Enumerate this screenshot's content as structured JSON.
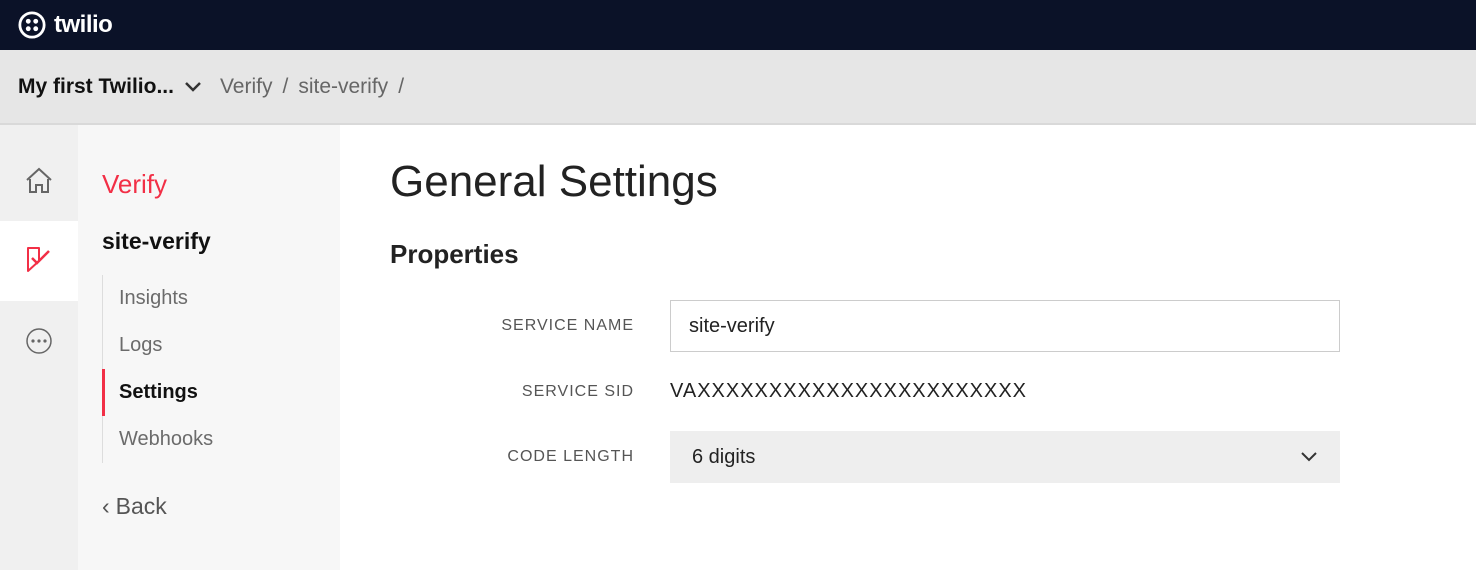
{
  "brand": "twilio",
  "breadcrumb": {
    "account": "My first Twilio...",
    "items": [
      "Verify",
      "site-verify"
    ]
  },
  "sidebar": {
    "product": "Verify",
    "service": "site-verify",
    "nav": [
      {
        "label": "Insights",
        "active": false
      },
      {
        "label": "Logs",
        "active": false
      },
      {
        "label": "Settings",
        "active": true
      },
      {
        "label": "Webhooks",
        "active": false
      }
    ],
    "back_label": "Back"
  },
  "page": {
    "title": "General Settings",
    "section": "Properties",
    "fields": {
      "service_name": {
        "label": "SERVICE NAME",
        "value": "site-verify"
      },
      "service_sid": {
        "label": "SERVICE SID",
        "value": "VAXXXXXXXXXXXXXXXXXXXXXXX"
      },
      "code_length": {
        "label": "CODE LENGTH",
        "value": "6 digits"
      }
    }
  }
}
